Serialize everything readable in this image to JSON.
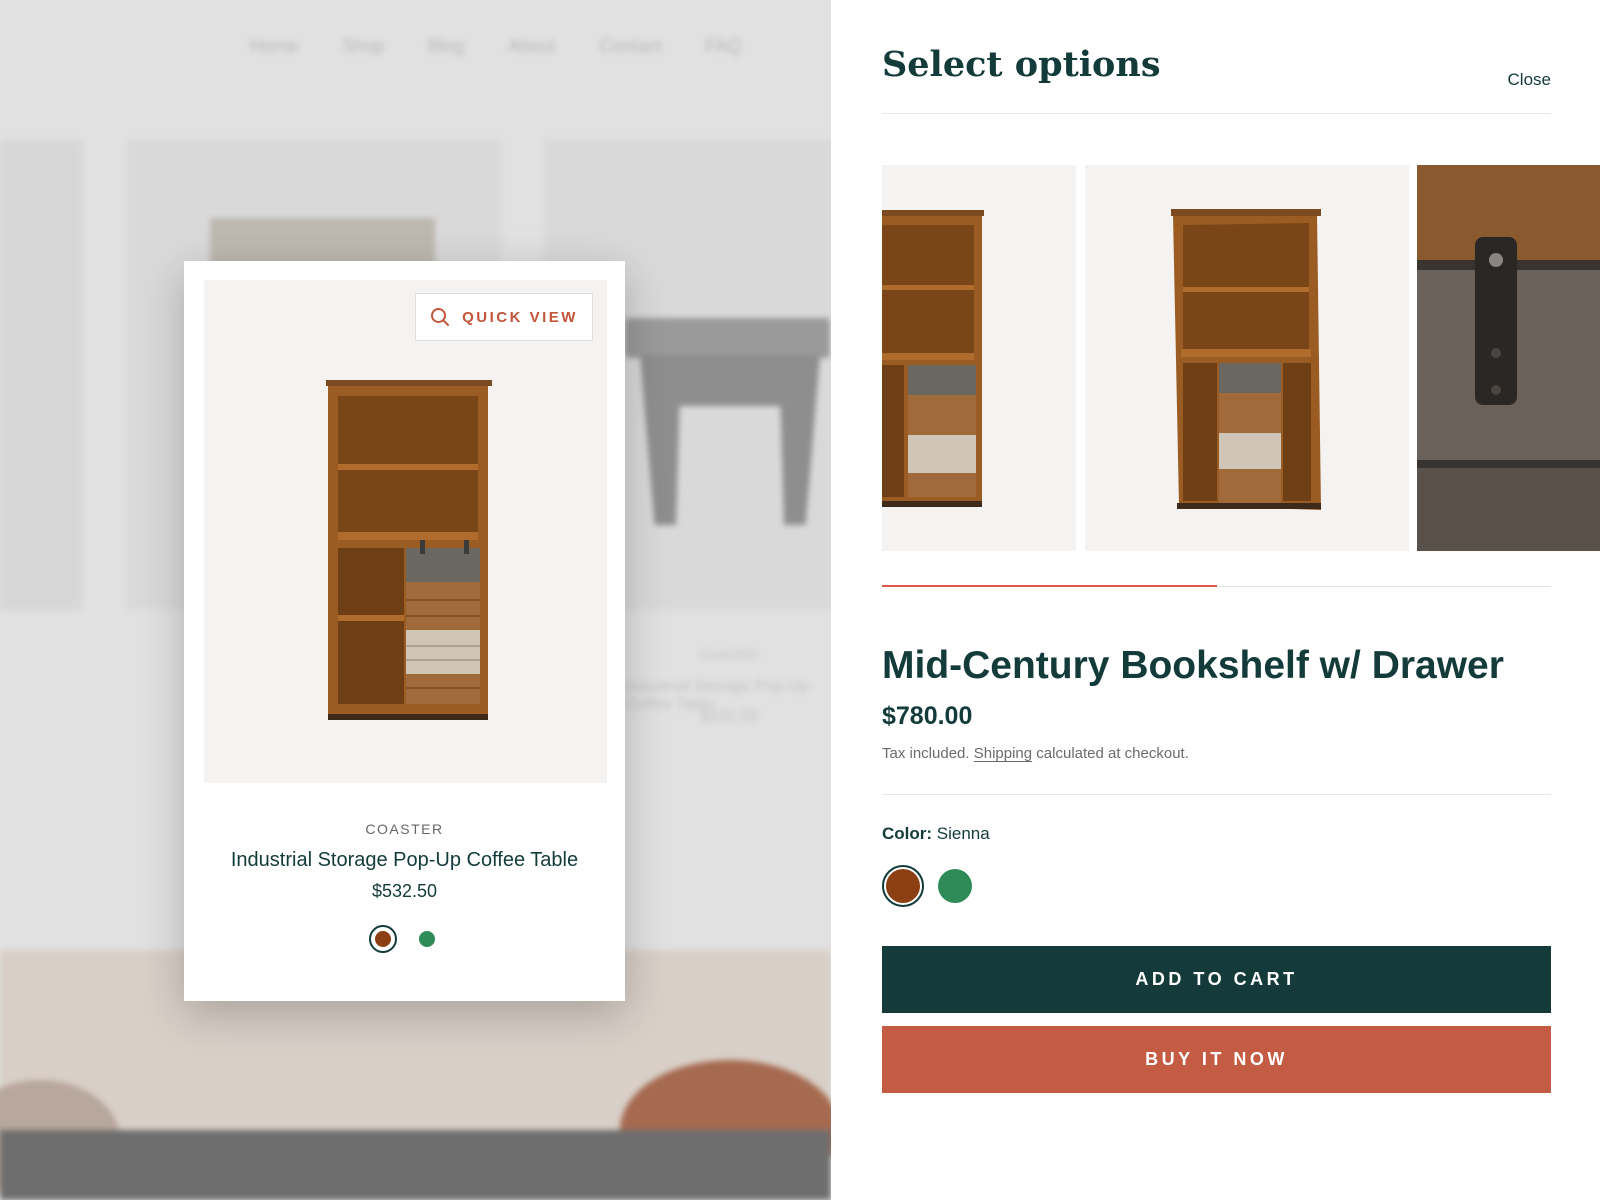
{
  "background": {
    "nav": [
      "Home",
      "Shop",
      "Blog",
      "About",
      "Contact",
      "FAQ"
    ],
    "card_vendor": "COASTER",
    "card_title": "Industrial Storage Pop-Up Coffee Table",
    "card_price": "$532.50"
  },
  "card": {
    "quick_view_label": "QUICK VIEW",
    "vendor": "COASTER",
    "title": "Industrial Storage Pop-Up Coffee Table",
    "price": "$532.50",
    "swatches": [
      {
        "name": "sienna",
        "color": "#8b3f12",
        "selected": true
      },
      {
        "name": "green",
        "color": "#2e8b57",
        "selected": false
      }
    ]
  },
  "drawer": {
    "title": "Select options",
    "close_label": "Close",
    "gallery_progress": 0.5,
    "product": {
      "title": "Mid-Century Bookshelf w/ Drawer",
      "price": "$780.00",
      "tax_prefix": "Tax included.",
      "shipping_link": "Shipping",
      "tax_suffix": "calculated at checkout."
    },
    "color": {
      "label": "Color:",
      "value": "Sienna",
      "options": [
        {
          "name": "sienna",
          "color": "#8b3f12",
          "selected": true
        },
        {
          "name": "green",
          "color": "#2e8b57",
          "selected": false
        }
      ]
    },
    "add_to_cart_label": "ADD TO CART",
    "buy_now_label": "BUY IT NOW"
  },
  "colors": {
    "brand_dark": "#143b39",
    "accent": "#c45c43",
    "progress": "#e2574a"
  }
}
